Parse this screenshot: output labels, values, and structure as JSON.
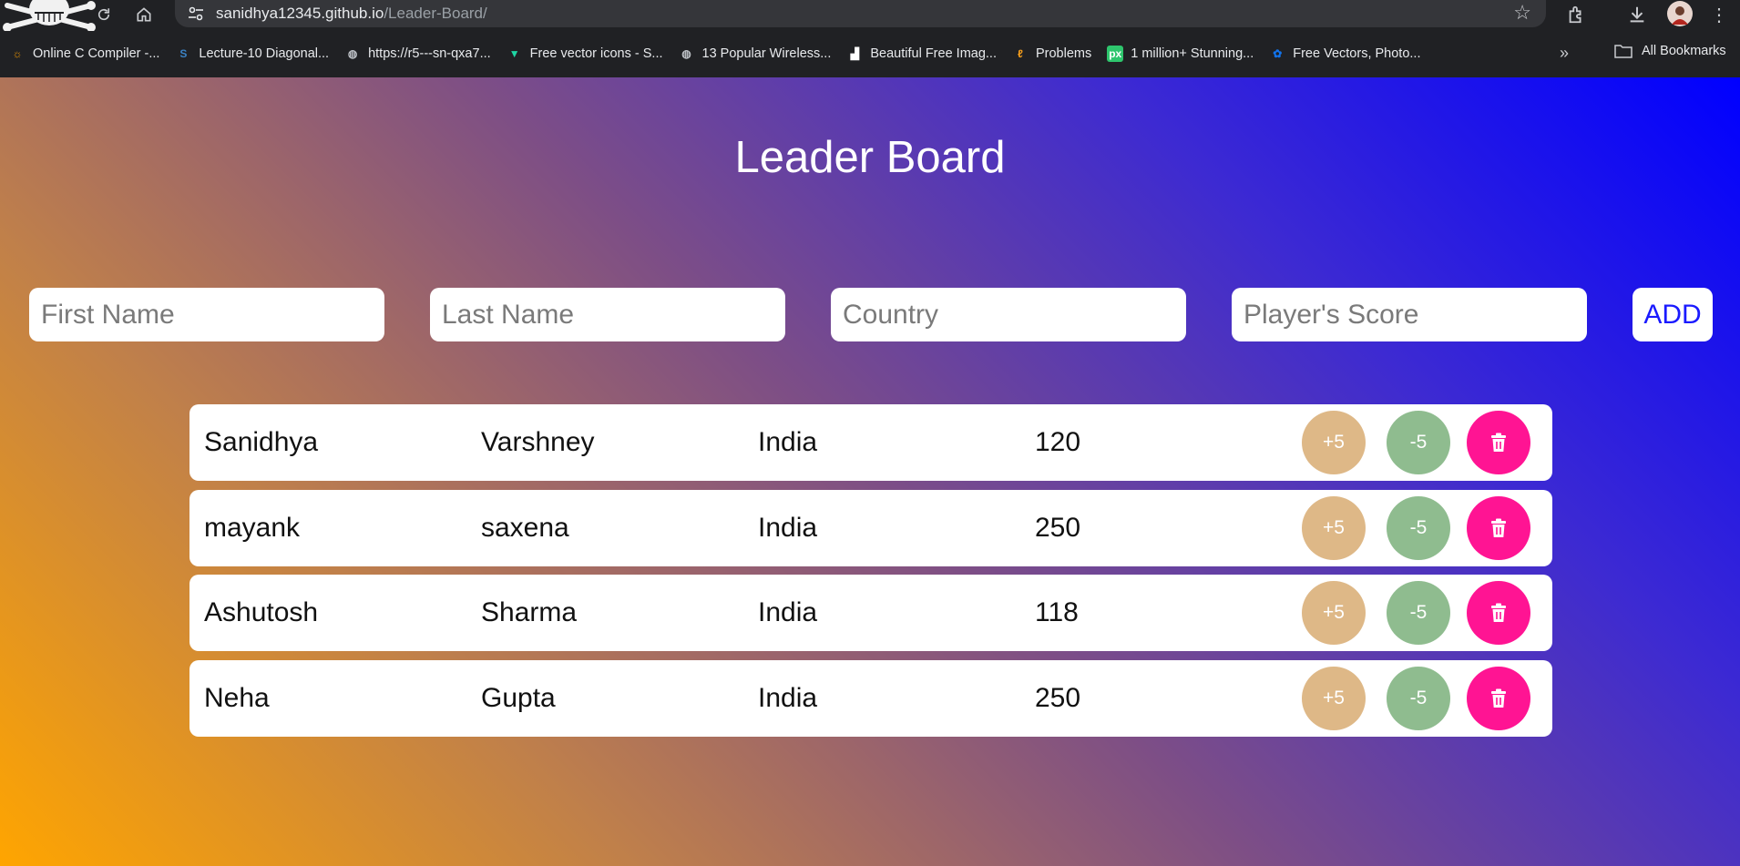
{
  "browser": {
    "url_domain": "sanidhya12345.github.io",
    "url_path": "/Leader-Board/",
    "bookmarks": [
      {
        "label": "Online C Compiler -...",
        "icon": "sun-icon",
        "color": "#f29900"
      },
      {
        "label": "Lecture-10 Diagonal...",
        "icon": "s-logo-icon",
        "color": "#3b82c4"
      },
      {
        "label": "https://r5---sn-qxa7...",
        "icon": "globe-icon",
        "color": "#bdc1c6"
      },
      {
        "label": "Free vector icons - S...",
        "icon": "v-logo-icon",
        "color": "#1ed6a4"
      },
      {
        "label": "13 Popular Wireless...",
        "icon": "globe-icon",
        "color": "#bdc1c6"
      },
      {
        "label": "Beautiful Free Imag...",
        "icon": "unsplash-icon",
        "color": "#ffffff"
      },
      {
        "label": "Problems",
        "icon": "leetcode-icon",
        "color": "#f89f1b"
      },
      {
        "label": "1 million+ Stunning...",
        "icon": "pixabay-icon",
        "color": "#2ec66d"
      },
      {
        "label": "Free Vectors, Photo...",
        "icon": "freepik-icon",
        "color": "#1273eb"
      }
    ],
    "all_bookmarks_label": "All Bookmarks"
  },
  "app": {
    "title": "Leader Board",
    "form": {
      "first_name_placeholder": "First Name",
      "last_name_placeholder": "Last Name",
      "country_placeholder": "Country",
      "score_placeholder": "Player's Score",
      "add_label": "ADD"
    },
    "players": [
      {
        "first": "Sanidhya",
        "last": "Varshney",
        "country": "India",
        "score": "120",
        "plus": "+5",
        "minus": "-5"
      },
      {
        "first": "mayank",
        "last": "saxena",
        "country": "India",
        "score": "250",
        "plus": "+5",
        "minus": "-5"
      },
      {
        "first": "Ashutosh",
        "last": "Sharma",
        "country": "India",
        "score": "118",
        "plus": "+5",
        "minus": "-5"
      },
      {
        "first": "Neha",
        "last": "Gupta",
        "country": "India",
        "score": "250",
        "plus": "+5",
        "minus": "-5"
      }
    ],
    "colors": {
      "plus_button": "#deb887",
      "minus_button": "#8fbc8f",
      "delete_button": "#ff1493",
      "add_text": "#1a1aff"
    }
  }
}
